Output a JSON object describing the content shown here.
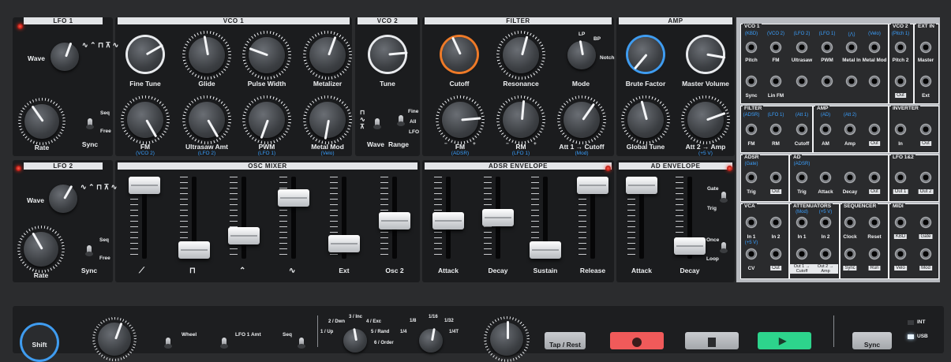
{
  "headers": {
    "lfo1": "LFO 1",
    "vco1": "VCO 1",
    "vco2": "VCO 2",
    "filter": "FILTER",
    "amp": "AMP",
    "lfo2": "LFO 2",
    "oscmix": "OSC MIXER",
    "adsr": "ADSR ENVELOPE",
    "ad": "AD ENVELOPE"
  },
  "lfo1": {
    "wave": "Wave",
    "rate": "Rate",
    "sync": "Sync",
    "seq": "Seq",
    "free": "Free"
  },
  "vco1": {
    "fine_tune": "Fine Tune",
    "glide": "Glide",
    "pulse_width": "Pulse Width",
    "metalizer": "Metalizer",
    "fm": "FM",
    "fm_sub": "(VCO 2)",
    "ultrasaw": "Ultrasaw Amt",
    "ultrasaw_sub": "(LFO 2)",
    "pwm": "PWM",
    "pwm_sub": "(LFO 1)",
    "metal_mod": "Metal Mod",
    "metal_mod_sub": "(Velo)"
  },
  "vco2": {
    "tune": "Tune",
    "wave": "Wave",
    "range": "Range",
    "fine": "Fine",
    "all": "All",
    "lfo": "LFO"
  },
  "filter": {
    "cutoff": "Cutoff",
    "resonance": "Resonance",
    "mode": "Mode",
    "lp": "LP",
    "bp": "BP",
    "notch": "Notch",
    "fm": "FM",
    "fm_sub": "(ADSR)",
    "rm": "RM",
    "rm_sub": "(LFO 1)",
    "att": "Att 1 → Cutoff",
    "att_sub": "(Mod)",
    "minus": "−",
    "plus": "+"
  },
  "amp": {
    "brute": "Brute Factor",
    "master": "Master Volume",
    "global": "Global Tune",
    "att2": "Att 2 → Amp",
    "att2_sub": "(+5 V)"
  },
  "lfo2": {
    "wave": "Wave",
    "rate": "Rate",
    "sync": "Sync",
    "seq": "Seq",
    "free": "Free"
  },
  "mixer": {
    "labels": [
      "",
      "",
      "",
      "",
      "Ext",
      "Osc 2"
    ],
    "levels": [
      1.0,
      0.0,
      0.22,
      0.8,
      0.1,
      0.45
    ]
  },
  "adsr": {
    "labels": [
      "Attack",
      "Decay",
      "Sustain",
      "Release"
    ],
    "levels": [
      0.45,
      0.5,
      0.0,
      1.0
    ]
  },
  "ad": {
    "labels": [
      "Attack",
      "Decay"
    ],
    "levels": [
      1.0,
      0.06
    ],
    "gate": "Gate",
    "trig": "Trig",
    "once": "Once",
    "loop": "Loop"
  },
  "patchbay": {
    "vco1": {
      "title": "VCO 1",
      "top_subs": [
        "(KBD)",
        "(VCO 2)",
        "(LFO 2)",
        "(LFO 1)",
        "(⋀)",
        "(Velo)"
      ],
      "row1": [
        "Pitch",
        "FM",
        "Ultrasaw",
        "PWM",
        "Metal In",
        "Metal Mod"
      ],
      "row2": [
        "Sync",
        "Lin FM",
        "",
        "",
        "",
        ""
      ]
    },
    "vco2": {
      "title": "VCO 2",
      "top_sub": "(Pitch 1)",
      "row1": "Pitch 2",
      "out": "Out"
    },
    "extin": {
      "title": "EXT IN",
      "row1": "Master",
      "row2": "Ext"
    },
    "filter": {
      "title": "FILTER",
      "subs": [
        "(ADSR)",
        "(LFO 1)",
        "(Att 1)"
      ],
      "labels": [
        "FM",
        "RM",
        "Cutoff"
      ]
    },
    "amp": {
      "title": "AMP",
      "subs": [
        "(AD)",
        "(Att 2)"
      ],
      "labels": [
        "AM",
        "Amp"
      ],
      "out": "Out"
    },
    "inverter": {
      "title": "INVERTER",
      "labels": [
        "In"
      ],
      "out": "Out"
    },
    "adsr": {
      "title": "ADSR",
      "sub": "(Gate)",
      "labels": [
        "Trig"
      ],
      "out": "Out"
    },
    "ad": {
      "title": "AD",
      "sub": "(ADSR)",
      "labels": [
        "Trig",
        "Attack",
        "Decay"
      ],
      "out": "Out"
    },
    "lfo12": {
      "title": "LFO 1&2",
      "outs": [
        "Out 1",
        "Out 2"
      ]
    },
    "vca": {
      "title": "VCA",
      "labels": [
        "In 1",
        "In 2"
      ],
      "sub": "(+5 V)",
      "cv": "CV",
      "out": "Out"
    },
    "atten": {
      "title": "ATTENUATORS",
      "subs": [
        "(Mod)",
        "(+5 V)"
      ],
      "labels": [
        "In 1",
        "In 2"
      ],
      "outs": [
        "Out 1 → Cutoff",
        "Out 2 → Amp"
      ]
    },
    "seq": {
      "title": "SEQUENCER",
      "labels": [
        "Clock",
        "Reset"
      ],
      "outs": [
        "Sync",
        "Run"
      ]
    },
    "midi": {
      "title": "MIDI",
      "outs": [
        "KBD",
        "Gate",
        "Velo",
        "Mod"
      ]
    }
  },
  "bottom": {
    "shift": "Shift",
    "wheel": "Wheel",
    "lfo1amt": "LFO 1 Amt",
    "seq": "Seq",
    "rate_labels": [
      "2 / Dwn",
      "3 / Inc",
      "4 / Exc",
      "1 / Up",
      "5 / Rand",
      "6 / Order"
    ],
    "div_labels": [
      "1/8",
      "1/16",
      "1/32",
      "1/4",
      "1/4T"
    ],
    "tap": "Tap / Rest",
    "sync": "Sync",
    "int": "INT",
    "usb": "USB"
  },
  "colors": {
    "panel": "#1b1c1e",
    "background": "#2b2c2e",
    "accent_blue": "#3aa0ff",
    "accent_orange": "#ee7a28",
    "record": "#f05a5a",
    "play": "#2dd48c"
  }
}
